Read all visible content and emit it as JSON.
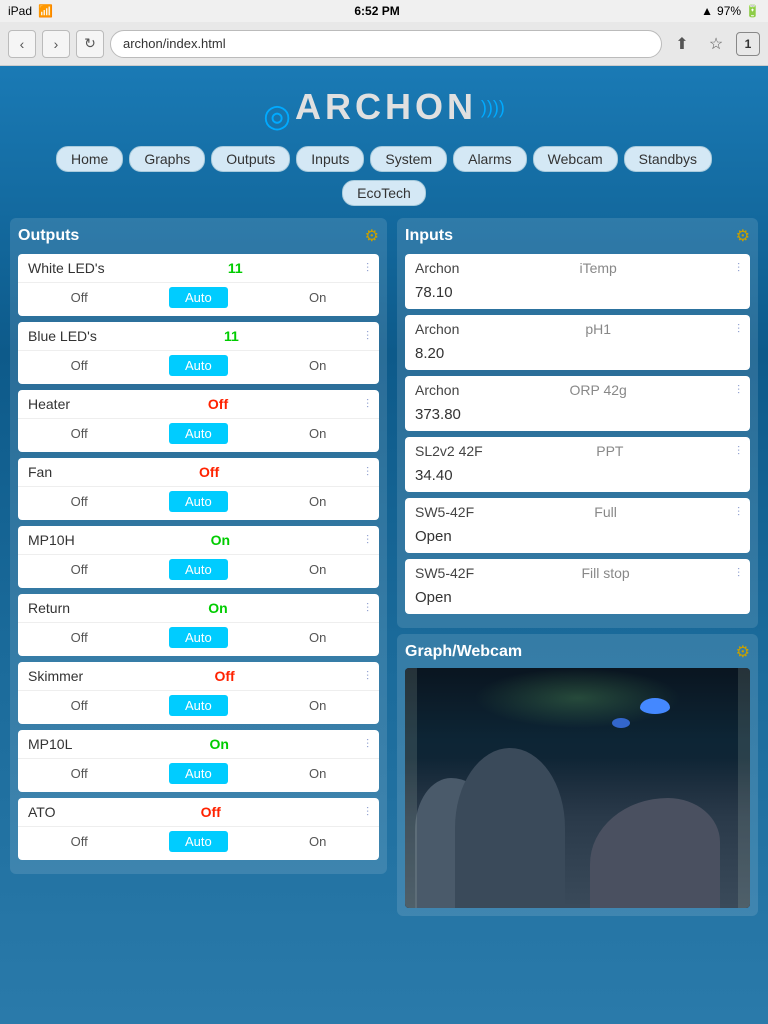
{
  "statusBar": {
    "carrier": "iPad",
    "wifi": "WiFi",
    "time": "6:52 PM",
    "battery": "97%"
  },
  "browserBar": {
    "url": "archon/index.html",
    "tabCount": "1"
  },
  "logo": {
    "text": "ARCHON"
  },
  "nav": {
    "items": [
      "Home",
      "Graphs",
      "Outputs",
      "Inputs",
      "System",
      "Alarms",
      "Webcam",
      "Standbys"
    ],
    "secondary": "EcoTech"
  },
  "outputs": {
    "title": "Outputs",
    "items": [
      {
        "name": "White LED's",
        "status": "11",
        "statusType": "num",
        "buttons": [
          "Off",
          "Auto",
          "On"
        ]
      },
      {
        "name": "Blue LED's",
        "status": "11",
        "statusType": "num",
        "buttons": [
          "Off",
          "Auto",
          "On"
        ]
      },
      {
        "name": "Heater",
        "status": "Off",
        "statusType": "red",
        "buttons": [
          "Off",
          "Auto",
          "On"
        ]
      },
      {
        "name": "Fan",
        "status": "Off",
        "statusType": "red",
        "buttons": [
          "Off",
          "Auto",
          "On"
        ]
      },
      {
        "name": "MP10H",
        "status": "On",
        "statusType": "green",
        "buttons": [
          "Off",
          "Auto",
          "On"
        ]
      },
      {
        "name": "Return",
        "status": "On",
        "statusType": "green",
        "buttons": [
          "Off",
          "Auto",
          "On"
        ]
      },
      {
        "name": "Skimmer",
        "status": "Off",
        "statusType": "red",
        "buttons": [
          "Off",
          "Auto",
          "On"
        ]
      },
      {
        "name": "MP10L",
        "status": "On",
        "statusType": "green",
        "buttons": [
          "Off",
          "Auto",
          "On"
        ]
      },
      {
        "name": "ATO",
        "status": "Off",
        "statusType": "red",
        "buttons": [
          "Off",
          "Auto",
          "On"
        ]
      }
    ]
  },
  "inputs": {
    "title": "Inputs",
    "items": [
      {
        "source": "Archon",
        "name": "iTemp",
        "value": "78.10"
      },
      {
        "source": "Archon",
        "name": "pH1",
        "value": "8.20"
      },
      {
        "source": "Archon",
        "name": "ORP 42g",
        "value": "373.80"
      },
      {
        "source": "SL2v2 42F",
        "name": "PPT",
        "value": "34.40"
      },
      {
        "source": "SW5-42F",
        "name": "Full",
        "value": "Open"
      },
      {
        "source": "SW5-42F",
        "name": "Fill stop",
        "value": "Open"
      }
    ]
  },
  "graphWebcam": {
    "title": "Graph/Webcam"
  },
  "buttons": {
    "off": "Off",
    "auto": "Auto",
    "on": "On"
  }
}
